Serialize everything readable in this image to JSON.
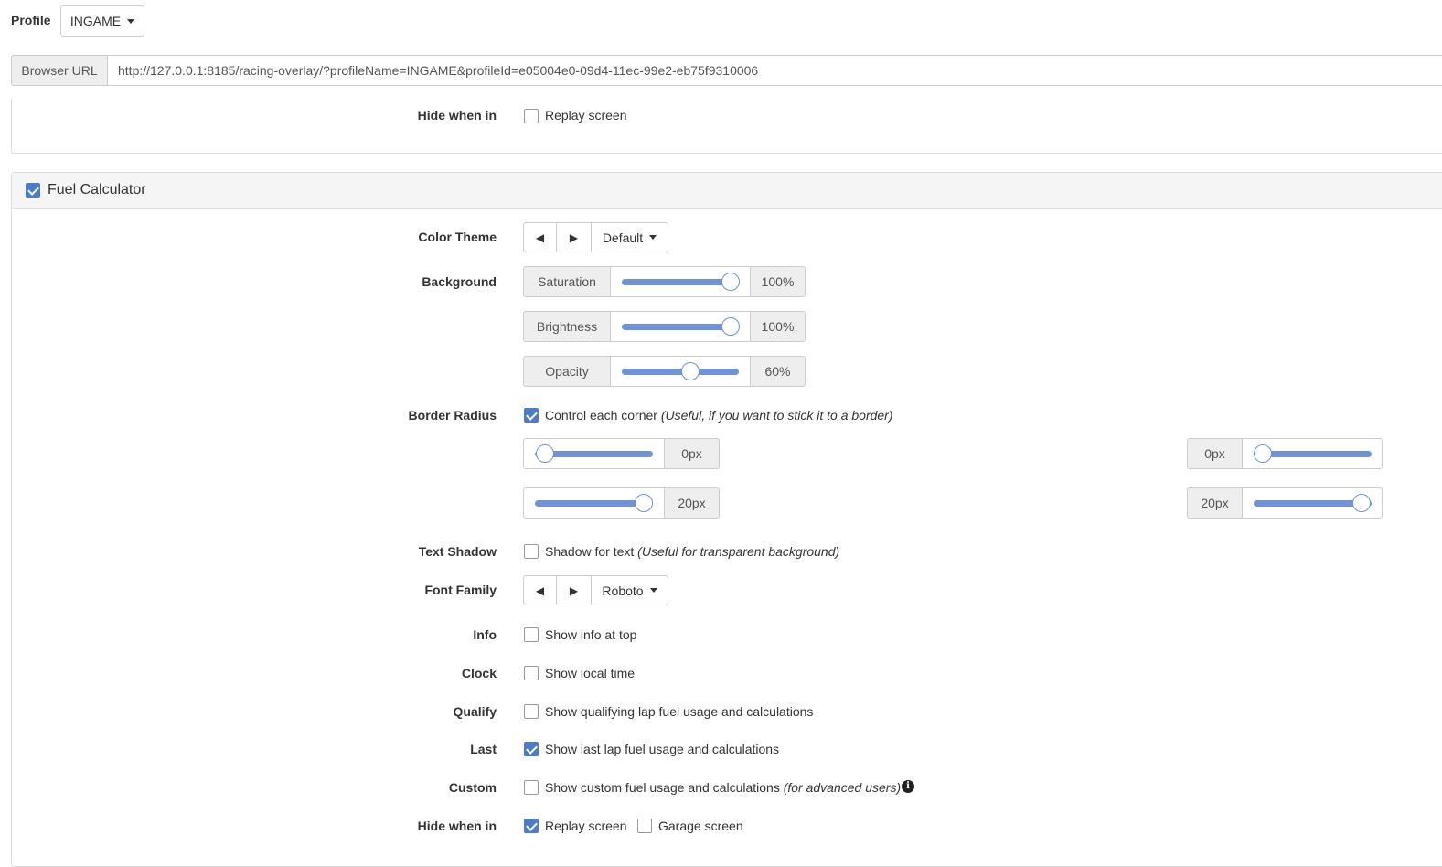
{
  "profile": {
    "label": "Profile",
    "value": "INGAME"
  },
  "browser_url": {
    "label": "Browser URL",
    "value": "http://127.0.0.1:8185/racing-overlay/?profileName=INGAME&profileId=e05004e0-09d4-11ec-99e2-eb75f9310006"
  },
  "prev_panel": {
    "hide_label": "Hide when in",
    "replay_label": "Replay screen",
    "replay_checked": false
  },
  "fuel": {
    "title": "Fuel Calculator",
    "enabled": true,
    "color_theme": {
      "label": "Color Theme",
      "prev": "◀",
      "next": "▶",
      "value": "Default"
    },
    "background": {
      "label": "Background",
      "saturation": {
        "label": "Saturation",
        "value": "100%",
        "level": 1.0
      },
      "brightness": {
        "label": "Brightness",
        "value": "100%",
        "level": 1.0
      },
      "opacity": {
        "label": "Opacity",
        "value": "60%",
        "level": 0.6
      }
    },
    "border_radius": {
      "label": "Border Radius",
      "control_label": "Control each corner",
      "control_hint": "(Useful, if you want to stick it to a border)",
      "control_checked": true,
      "top_left": {
        "value": "0px",
        "level": 0.0
      },
      "top_right": {
        "value": "0px",
        "level": 0.0
      },
      "bottom_left": {
        "value": "20px",
        "level": 1.0
      },
      "bottom_right": {
        "value": "20px",
        "level": 1.0
      }
    },
    "text_shadow": {
      "label": "Text Shadow",
      "option": "Shadow for text",
      "hint": "(Useful for transparent background)",
      "checked": false
    },
    "font_family": {
      "label": "Font Family",
      "prev": "◀",
      "next": "▶",
      "value": "Roboto"
    },
    "info": {
      "label": "Info",
      "option": "Show info at top",
      "checked": false
    },
    "clock": {
      "label": "Clock",
      "option": "Show local time",
      "checked": false
    },
    "qualify": {
      "label": "Qualify",
      "option": "Show qualifying lap fuel usage and calculations",
      "checked": false
    },
    "last": {
      "label": "Last",
      "option": "Show last lap fuel usage and calculations",
      "checked": true
    },
    "custom": {
      "label": "Custom",
      "option": "Show custom fuel usage and calculations",
      "hint": "(for advanced users)",
      "checked": false
    },
    "hide_when": {
      "label": "Hide when in",
      "replay": "Replay screen",
      "replay_checked": true,
      "garage": "Garage screen",
      "garage_checked": false
    }
  },
  "colors": {
    "accent": "#4a7cc9",
    "slider": "#6f93d6"
  }
}
